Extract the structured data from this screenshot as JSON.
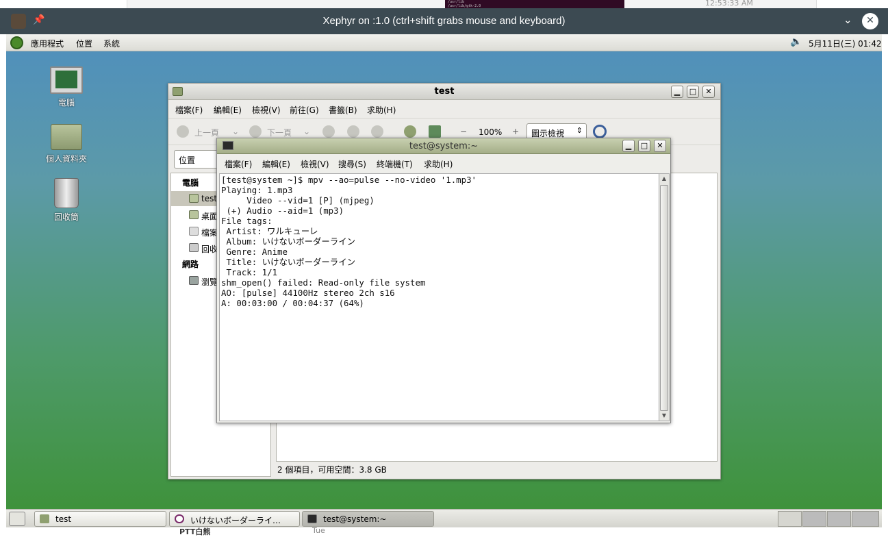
{
  "background": {
    "top_time": "12:53:33 AM",
    "top_term_lines": [
      "/usr/lib",
      "/usr/lib/gtk-2.0"
    ],
    "bottom_items": [
      "PTT白熊",
      "Tue"
    ]
  },
  "xephyr": {
    "title": "Xephyr on :1.0 (ctrl+shift grabs mouse and keyboard)",
    "pin_icon": "pin-icon",
    "chevron_icon": "chevron-down-icon",
    "close_label": "✕"
  },
  "top_panel": {
    "menus": [
      "應用程式",
      "位置",
      "系統"
    ],
    "clock": "5月11日(三) 01:42"
  },
  "desktop_icons": [
    {
      "label": "電腦",
      "icon": "computer-icon"
    },
    {
      "label": "個人資料夾",
      "icon": "home-folder-icon"
    },
    {
      "label": "回收筒",
      "icon": "trash-icon"
    }
  ],
  "filemgr": {
    "title": "test",
    "menus": [
      "檔案(F)",
      "編輯(E)",
      "檢視(V)",
      "前往(G)",
      "書籤(B)",
      "求助(H)"
    ],
    "toolbar": {
      "back": "上一頁",
      "forward": "下一頁",
      "zoom": "100%",
      "view_mode": "圖示檢視",
      "zoom_out": "−",
      "zoom_in": "+"
    },
    "location_label": "位置",
    "sidebar": {
      "computer_header": "電腦",
      "network_header": "網路",
      "items": [
        "test",
        "桌面",
        "檔案",
        "回收",
        "瀏覽"
      ]
    },
    "status": "2 個項目，可用空間：3.8 GB"
  },
  "terminal": {
    "title": "test@system:~",
    "menus": [
      "檔案(F)",
      "編輯(E)",
      "檢視(V)",
      "搜尋(S)",
      "終端機(T)",
      "求助(H)"
    ],
    "lines": [
      "[test@system ~]$ mpv --ao=pulse --no-video '1.mp3'",
      "Playing: 1.mp3",
      "     Video --vid=1 [P] (mjpeg)",
      " (+) Audio --aid=1 (mp3)",
      "File tags:",
      " Artist: ワルキューレ",
      " Album: いけないボーダーライン",
      " Genre: Anime",
      " Title: いけないボーダーライン",
      " Track: 1/1",
      "shm_open() failed: Read-only file system",
      "AO: [pulse] 44100Hz stereo 2ch s16",
      "A: 00:03:00 / 00:04:37 (64%)"
    ]
  },
  "taskbar": {
    "tasks": [
      {
        "label": "test",
        "icon": "folder-icon",
        "active": false
      },
      {
        "label": "いけないボーダーライ…",
        "icon": "media-player-icon",
        "active": false
      },
      {
        "label": "test@system:~",
        "icon": "terminal-icon",
        "active": true
      }
    ]
  }
}
